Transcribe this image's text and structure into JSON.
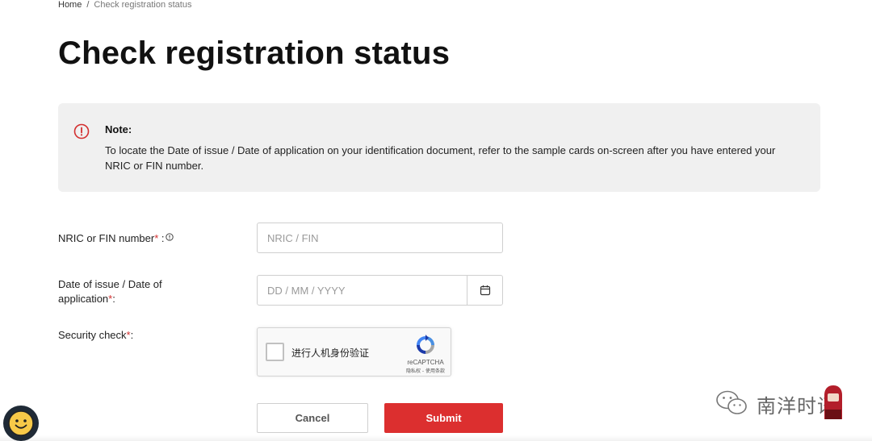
{
  "breadcrumb": {
    "home": "Home",
    "separator": "/",
    "current": "Check registration status"
  },
  "page": {
    "title": "Check registration status"
  },
  "note": {
    "icon": "info-circle-icon",
    "title": "Note:",
    "body": "To locate the Date of issue / Date of application on your identification document, refer to the sample cards on-screen after you have entered your NRIC or FIN number."
  },
  "form": {
    "nric": {
      "label": "NRIC or FIN number",
      "required_mark": "*",
      "suffix": ":",
      "placeholder": "NRIC / FIN",
      "value": ""
    },
    "date": {
      "label": "Date of issue / Date of application",
      "required_mark": "*",
      "suffix": ":",
      "placeholder": "DD / MM / YYYY",
      "value": ""
    },
    "security": {
      "label": "Security check",
      "required_mark": "*",
      "suffix": ":",
      "captcha_label": "进行人机身份验证",
      "captcha_brand": "reCAPTCHA",
      "captcha_links": "隐私权 - 使用条款",
      "checked": false
    }
  },
  "actions": {
    "cancel_label": "Cancel",
    "submit_label": "Submit"
  },
  "watermark": {
    "text": "南洋时讯"
  },
  "colors": {
    "accent": "#dc2f2f",
    "required": "#d32f2f",
    "note_bg": "#f0f0f0",
    "avatar_bg": "#1f2a36",
    "smiley": "#f7c948"
  }
}
